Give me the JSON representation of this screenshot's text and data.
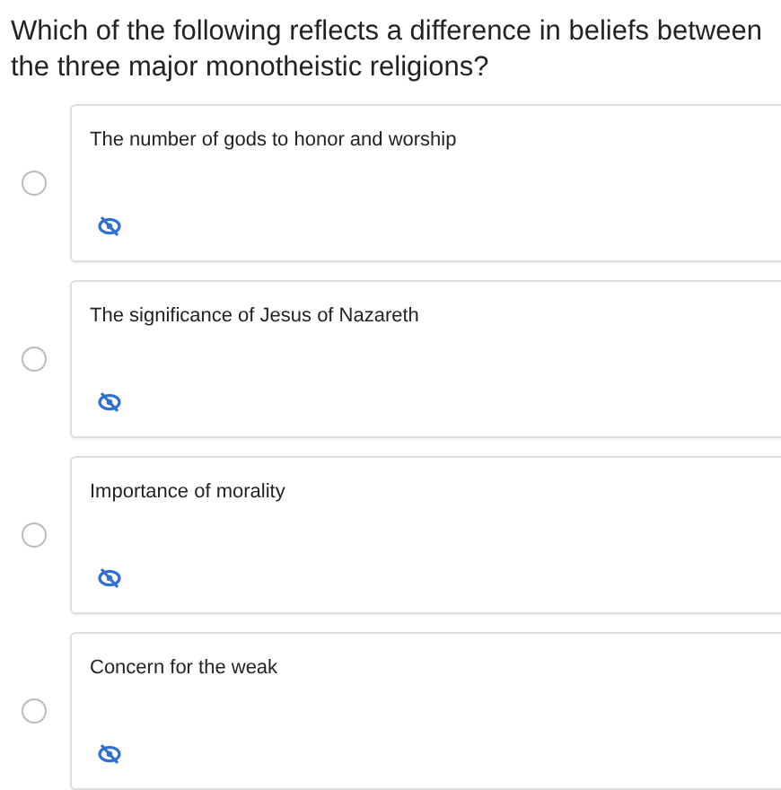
{
  "question": "Which of the following reflects a difference in beliefs between the three major monotheistic religions?",
  "options": [
    {
      "label": "The number of gods to honor and worship",
      "selected": false
    },
    {
      "label": "The significance of Jesus of Nazareth",
      "selected": false
    },
    {
      "label": "Importance of morality",
      "selected": false
    },
    {
      "label": "Concern for the weak",
      "selected": false
    }
  ]
}
